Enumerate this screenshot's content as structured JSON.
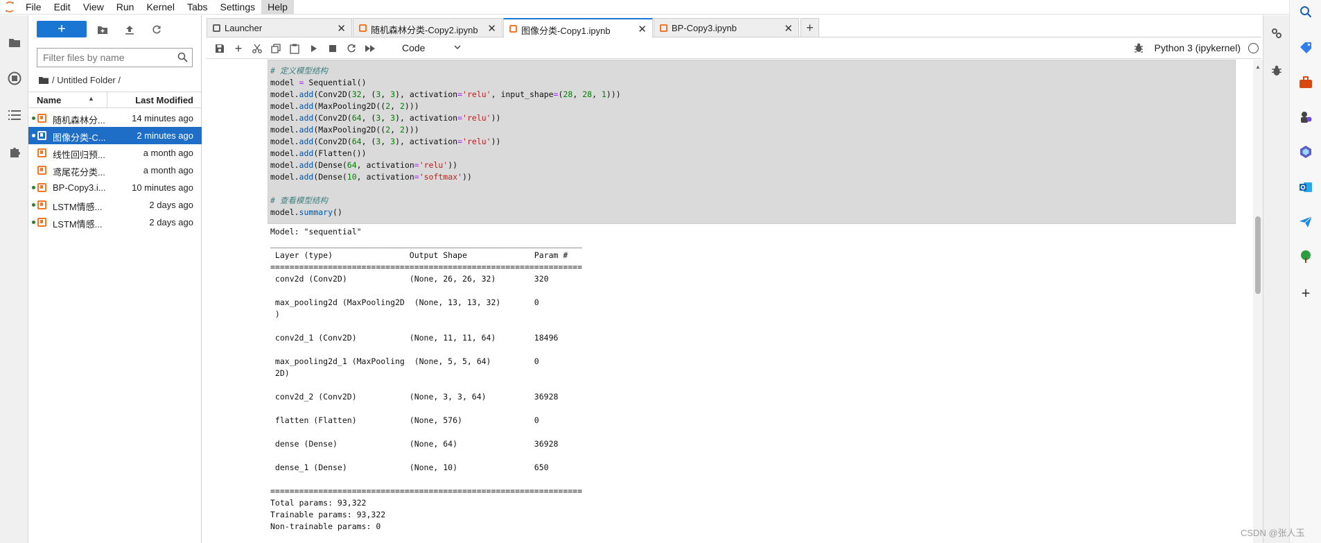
{
  "menubar": {
    "items": [
      "File",
      "Edit",
      "View",
      "Run",
      "Kernel",
      "Tabs",
      "Settings",
      "Help"
    ],
    "active": "Help"
  },
  "filebrowser": {
    "new_label": "+",
    "filter_placeholder": "Filter files by name",
    "breadcrumb": "/ Untitled Folder /",
    "col_name": "Name",
    "col_modified": "Last Modified",
    "files": [
      {
        "name": "随机森林分...",
        "modified": "14 minutes ago",
        "running": true,
        "selected": false
      },
      {
        "name": "图像分类-C...",
        "modified": "2 minutes ago",
        "running": true,
        "selected": true
      },
      {
        "name": "线性回归预...",
        "modified": "a month ago",
        "running": false,
        "selected": false
      },
      {
        "name": "鸢尾花分类...",
        "modified": "a month ago",
        "running": false,
        "selected": false
      },
      {
        "name": "BP-Copy3.i...",
        "modified": "10 minutes ago",
        "running": true,
        "selected": false
      },
      {
        "name": "LSTM情感...",
        "modified": "2 days ago",
        "running": true,
        "selected": false
      },
      {
        "name": "LSTM情感...",
        "modified": "2 days ago",
        "running": true,
        "selected": false
      }
    ]
  },
  "tabs": [
    {
      "label": "Launcher",
      "active": false
    },
    {
      "label": "随机森林分类-Copy2.ipynb",
      "active": false
    },
    {
      "label": "图像分类-Copy1.ipynb",
      "active": true
    },
    {
      "label": "BP-Copy3.ipynb",
      "active": false
    }
  ],
  "toolbar": {
    "cell_type": "Code",
    "kernel": "Python 3 (ipykernel)"
  },
  "cell": {
    "code_lines": [
      "# 定义模型结构",
      "model = Sequential()",
      "model.add(Conv2D(32, (3, 3), activation='relu', input_shape=(28, 28, 1)))",
      "model.add(MaxPooling2D((2, 2)))",
      "model.add(Conv2D(64, (3, 3), activation='relu'))",
      "model.add(MaxPooling2D((2, 2)))",
      "model.add(Conv2D(64, (3, 3), activation='relu'))",
      "model.add(Flatten())",
      "model.add(Dense(64, activation='relu'))",
      "model.add(Dense(10, activation='softmax'))",
      "",
      "# 查看模型结构",
      "model.summary()"
    ],
    "output": "Model: \"sequential\"\n_________________________________________________________________\n Layer (type)                Output Shape              Param #   \n=================================================================\n conv2d (Conv2D)             (None, 26, 26, 32)        320       \n                                                                 \n max_pooling2d (MaxPooling2D  (None, 13, 13, 32)       0         \n )                                                               \n                                                                 \n conv2d_1 (Conv2D)           (None, 11, 11, 64)        18496     \n                                                                 \n max_pooling2d_1 (MaxPooling  (None, 5, 5, 64)         0         \n 2D)                                                             \n                                                                 \n conv2d_2 (Conv2D)           (None, 3, 3, 64)          36928     \n                                                                 \n flatten (Flatten)           (None, 576)               0         \n                                                                 \n dense (Dense)               (None, 64)                36928     \n                                                                 \n dense_1 (Dense)             (None, 10)                650       \n                                                                 \n=================================================================\nTotal params: 93,322\nTrainable params: 93,322\nNon-trainable params: 0"
  },
  "watermark": "CSDN @张人玉",
  "colors": {
    "accent": "#1976d2",
    "notebook_icon": "#f37726",
    "running_dot": "#2e7d32",
    "selected_row": "#1e6ec8",
    "cell_background": "#dadada"
  },
  "icons": {
    "activity": [
      "folder-icon",
      "running-icon",
      "toc-icon",
      "extension-icon"
    ],
    "filebrowser_tools": [
      "new-folder-icon",
      "upload-icon",
      "refresh-icon"
    ],
    "notebook_tools": [
      "save-icon",
      "add-cell-icon",
      "cut-icon",
      "copy-icon",
      "paste-icon",
      "run-icon",
      "stop-icon",
      "restart-icon",
      "fast-forward-icon"
    ],
    "right_panel": [
      "property-inspector-icon",
      "debugger-icon"
    ],
    "edge_sidebar": [
      "search-icon",
      "shopping-icon",
      "tools-icon",
      "games-icon",
      "copilot-icon",
      "outlook-icon",
      "send-icon",
      "tree-icon",
      "add-icon"
    ]
  }
}
